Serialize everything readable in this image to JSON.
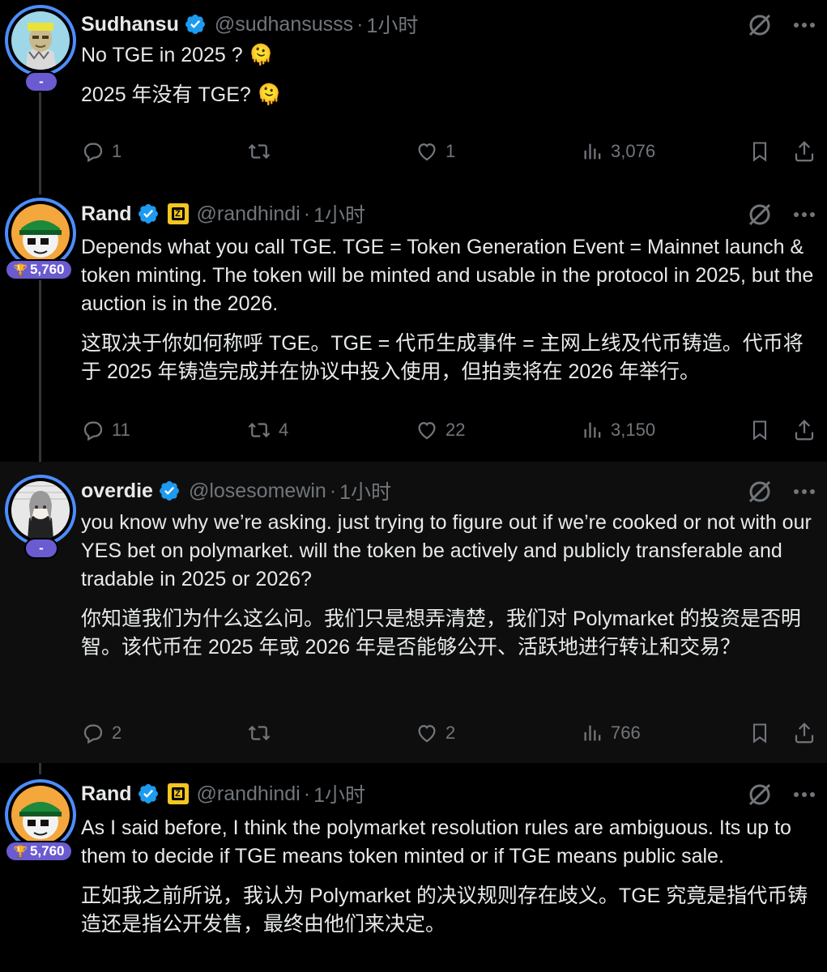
{
  "posts": [
    {
      "name": "Sudhansu",
      "handle": "@sudhansusss",
      "time": "1小时",
      "badge": "-",
      "lines": [
        "No TGE in 2025 ? 🫠",
        "2025 年没有 TGE?  🫠"
      ],
      "replies": "1",
      "reposts": "",
      "likes": "1",
      "views": "3,076"
    },
    {
      "name": "Rand",
      "handle": "@randhindi",
      "time": "1小时",
      "badge": "5,760",
      "lines": [
        "Depends what you call TGE. TGE = Token Generation Event = Mainnet launch & token minting. The token will be minted and usable in the protocol in 2025, but the auction is in the 2026.",
        "这取决于你如何称呼 TGE。TGE = 代币生成事件 = 主网上线及代币铸造。代币将于 2025 年铸造完成并在协议中投入使用，但拍卖将在 2026 年举行。"
      ],
      "replies": "11",
      "reposts": "4",
      "likes": "22",
      "views": "3,150"
    },
    {
      "name": "overdie",
      "handle": "@losesomewin",
      "time": "1小时",
      "badge": "-",
      "lines": [
        "you know why we’re asking. just trying to figure out if we’re cooked or not with our YES bet on polymarket. will the token be actively and publicly transferable and tradable in 2025 or 2026?",
        "你知道我们为什么这么问。我们只是想弄清楚，我们对 Polymarket 的投资是否明智。该代币在 2025 年或 2026 年是否能够公开、活跃地进行转让和交易？"
      ],
      "replies": "2",
      "reposts": "",
      "likes": "2",
      "views": "766"
    },
    {
      "name": "Rand",
      "handle": "@randhindi",
      "time": "1小时",
      "badge": "5,760",
      "lines": [
        "As I said before, I think the polymarket resolution rules are ambiguous. Its up to them to decide if TGE means token minted or if TGE means public sale.",
        "正如我之前所说，我认为 Polymarket 的决议规则存在歧义。TGE 究竟是指代币铸造还是指公开发售，最终由他们来决定。"
      ]
    }
  ],
  "colors": {
    "accent": "#1d9bf0",
    "muted": "#71767b",
    "ring": "#4d8dff",
    "badge": "#6a5bd1"
  }
}
